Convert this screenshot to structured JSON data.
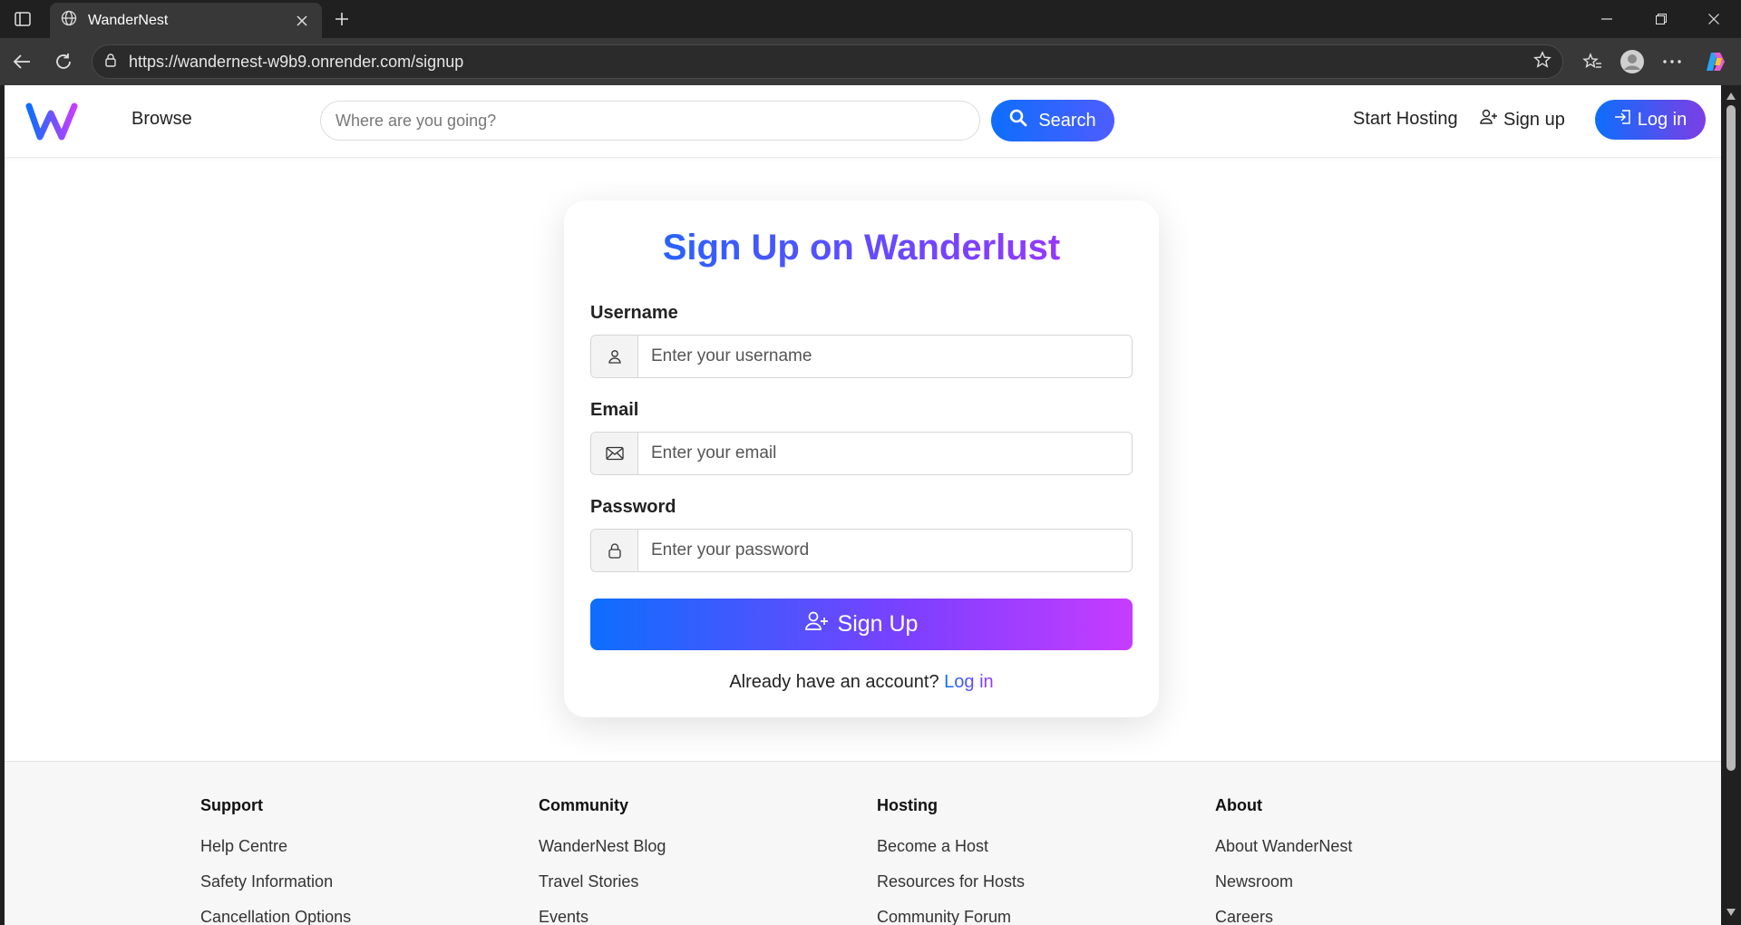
{
  "browser": {
    "tab_title": "WanderNest",
    "url": "https://wandernest-w9b9.onrender.com/signup"
  },
  "navbar": {
    "browse_label": "Browse",
    "search_placeholder": "Where are you going?",
    "search_button_label": "Search",
    "start_hosting_label": "Start Hosting",
    "signup_label": "Sign up",
    "login_label": "Log in"
  },
  "signup_form": {
    "title": "Sign Up on Wanderlust",
    "username_label": "Username",
    "username_placeholder": "Enter your username",
    "email_label": "Email",
    "email_placeholder": "Enter your email",
    "password_label": "Password",
    "password_placeholder": "Enter your password",
    "submit_label": "Sign Up",
    "already_text": "Already have an account?",
    "login_link": "Log in"
  },
  "footer": {
    "columns": [
      {
        "heading": "Support",
        "items": [
          "Help Centre",
          "Safety Information",
          "Cancellation Options"
        ]
      },
      {
        "heading": "Community",
        "items": [
          "WanderNest Blog",
          "Travel Stories",
          "Events"
        ]
      },
      {
        "heading": "Hosting",
        "items": [
          "Become a Host",
          "Resources for Hosts",
          "Community Forum"
        ]
      },
      {
        "heading": "About",
        "items": [
          "About WanderNest",
          "Newsroom",
          "Careers"
        ]
      }
    ]
  },
  "colors": {
    "brand_blue": "#0d6efd",
    "brand_purple": "#c73cff"
  }
}
